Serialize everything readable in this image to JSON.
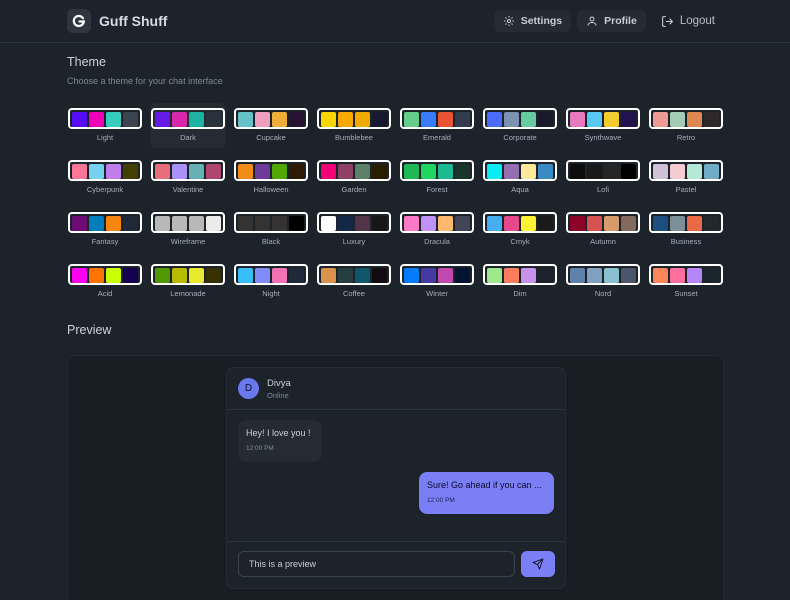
{
  "header": {
    "app_title": "Guff Shuff",
    "logo_letter": "G",
    "nav": {
      "settings": "Settings",
      "profile": "Profile",
      "logout": "Logout"
    }
  },
  "theme": {
    "title": "Theme",
    "subtitle": "Choose a theme for your chat interface",
    "selected": "Dark",
    "themes": [
      {
        "name": "Light",
        "colors": [
          "#570df8",
          "#f000b8",
          "#37cdbe",
          "#3d4451"
        ]
      },
      {
        "name": "Dark",
        "colors": [
          "#661ae6",
          "#d926aa",
          "#1fb2a5",
          "#2a323c"
        ]
      },
      {
        "name": "Cupcake",
        "colors": [
          "#65c3c8",
          "#ef9fbc",
          "#eeaf3a",
          "#291334"
        ]
      },
      {
        "name": "Bumblebee",
        "colors": [
          "#fad600",
          "#f9a800",
          "#f1aa00",
          "#181830"
        ]
      },
      {
        "name": "Emerald",
        "colors": [
          "#66cc8a",
          "#377cfb",
          "#ea5234",
          "#333c4d"
        ]
      },
      {
        "name": "Corporate",
        "colors": [
          "#4b6bfb",
          "#7b92b2",
          "#67cba0",
          "#181a2a"
        ]
      },
      {
        "name": "Synthwave",
        "colors": [
          "#e779c1",
          "#58c7f3",
          "#f3cc30",
          "#20134e"
        ]
      },
      {
        "name": "Retro",
        "colors": [
          "#ef9995",
          "#a4cbb4",
          "#dc8850",
          "#2e282a"
        ]
      },
      {
        "name": "Cyberpunk",
        "colors": [
          "#ff7598",
          "#75d1f0",
          "#c07eec",
          "#423f00"
        ]
      },
      {
        "name": "Valentine",
        "colors": [
          "#e96d7b",
          "#a991f7",
          "#66b1b3",
          "#af4670"
        ]
      },
      {
        "name": "Halloween",
        "colors": [
          "#f28c18",
          "#6d3a9c",
          "#51a800",
          "#2f1b05"
        ]
      },
      {
        "name": "Garden",
        "colors": [
          "#f40076",
          "#8e4162",
          "#5c7f67",
          "#291e00"
        ]
      },
      {
        "name": "Forest",
        "colors": [
          "#1eb854",
          "#1fd65f",
          "#1db990",
          "#19362d"
        ]
      },
      {
        "name": "Aqua",
        "colors": [
          "#09ecf3",
          "#966fb3",
          "#ffe999",
          "#3b8ac4"
        ]
      },
      {
        "name": "Lofi",
        "colors": [
          "#0d0d0d",
          "#1a1919",
          "#262626",
          "#000000"
        ]
      },
      {
        "name": "Pastel",
        "colors": [
          "#d1c1d7",
          "#f6cbd1",
          "#b4e9d6",
          "#70acc7"
        ]
      },
      {
        "name": "Fantasy",
        "colors": [
          "#6e0b75",
          "#007ebd",
          "#f8860d",
          "#1f2937"
        ]
      },
      {
        "name": "Wireframe",
        "colors": [
          "#b8b8b8",
          "#b8b8b8",
          "#b8b8b8",
          "#ebebeb"
        ]
      },
      {
        "name": "Black",
        "colors": [
          "#343232",
          "#343232",
          "#343232",
          "#000000"
        ]
      },
      {
        "name": "Luxury",
        "colors": [
          "#ffffff",
          "#152747",
          "#513448",
          "#171618"
        ]
      },
      {
        "name": "Dracula",
        "colors": [
          "#ff79c6",
          "#bd93f9",
          "#ffb86c",
          "#414558"
        ]
      },
      {
        "name": "Cmyk",
        "colors": [
          "#45aeee",
          "#e8488a",
          "#fff232",
          "#1a1a1a"
        ]
      },
      {
        "name": "Autumn",
        "colors": [
          "#8c0327",
          "#d85251",
          "#d59b6a",
          "#826a5c"
        ]
      },
      {
        "name": "Business",
        "colors": [
          "#1c4e80",
          "#7c909a",
          "#ea6947",
          "#23282e"
        ]
      },
      {
        "name": "Acid",
        "colors": [
          "#ff00f4",
          "#ff7400",
          "#cbfd03",
          "#140152"
        ]
      },
      {
        "name": "Lemonade",
        "colors": [
          "#519903",
          "#b9bb00",
          "#e9e92f",
          "#393000"
        ]
      },
      {
        "name": "Night",
        "colors": [
          "#38bdf8",
          "#818cf8",
          "#f471b5",
          "#1e293b"
        ]
      },
      {
        "name": "Coffee",
        "colors": [
          "#db924b",
          "#263e3f",
          "#10576d",
          "#120c12"
        ]
      },
      {
        "name": "Winter",
        "colors": [
          "#047aff",
          "#463aa2",
          "#c148ac",
          "#021431"
        ]
      },
      {
        "name": "Dim",
        "colors": [
          "#9fe88d",
          "#ff7d5c",
          "#c792e9",
          "#1c212b"
        ]
      },
      {
        "name": "Nord",
        "colors": [
          "#5e81ac",
          "#81a1c1",
          "#88c0d0",
          "#4c566a"
        ]
      },
      {
        "name": "Sunset",
        "colors": [
          "#ff865b",
          "#fd6f9c",
          "#b387fa",
          "#1b262c"
        ]
      }
    ]
  },
  "preview": {
    "title": "Preview",
    "contact": {
      "initial": "D",
      "name": "Divya",
      "status": "Online"
    },
    "messages": [
      {
        "text": "Hey! I love you !",
        "time": "12:00 PM",
        "direction": "in"
      },
      {
        "text": "Sure! Go ahead if you can ...",
        "time": "12:00 PM",
        "direction": "out"
      }
    ],
    "input_value": "This is a preview"
  },
  "colors": {
    "background": "#1d232a",
    "accent": "#7b7ff6",
    "tile_border": "#ffffff"
  }
}
